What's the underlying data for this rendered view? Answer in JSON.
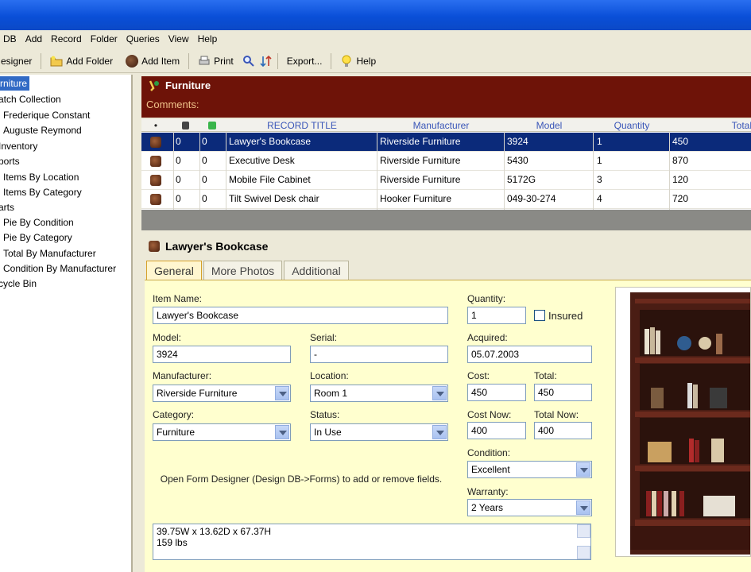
{
  "menu": [
    "n DB",
    "Add",
    "Record",
    "Folder",
    "Queries",
    "View",
    "Help"
  ],
  "toolbar": {
    "designer": "esigner",
    "add_folder": "Add Folder",
    "add_item": "Add Item",
    "print": "Print",
    "export": "Export...",
    "help": "Help"
  },
  "sidebar": [
    "rniture",
    "atch Collection",
    "Frederique Constant",
    "Auguste Reymond",
    "Inventory",
    "ports",
    "Items By Location",
    "Items By Category",
    "arts",
    "Pie By Condition",
    "Pie By Category",
    "Total By Manufacturer",
    "Condition By Manufacturer",
    "cycle Bin"
  ],
  "header": {
    "title": "Furniture",
    "comments": "Comments:"
  },
  "grid": {
    "columns": [
      "•",
      "",
      "",
      "RECORD TITLE",
      "Manufacturer",
      "Model",
      "Quantity",
      "Total"
    ],
    "rows": [
      {
        "a": "0",
        "b": "0",
        "title": "Lawyer's Bookcase",
        "manufacturer": "Riverside Furniture",
        "model": "3924",
        "quantity": "1",
        "total": "450"
      },
      {
        "a": "0",
        "b": "0",
        "title": "Executive Desk",
        "manufacturer": "Riverside Furniture",
        "model": "5430",
        "quantity": "1",
        "total": "870"
      },
      {
        "a": "0",
        "b": "0",
        "title": "Mobile File Cabinet",
        "manufacturer": "Riverside Furniture",
        "model": "5172G",
        "quantity": "3",
        "total": "120"
      },
      {
        "a": "0",
        "b": "0",
        "title": "Tilt Swivel Desk chair",
        "manufacturer": "Hooker Furniture",
        "model": "049-30-274",
        "quantity": "4",
        "total": "720"
      }
    ]
  },
  "detail": {
    "title": "Lawyer's Bookcase",
    "tabs": [
      "General",
      "More Photos",
      "Additional"
    ],
    "labels": {
      "item_name": "Item Name:",
      "model": "Model:",
      "serial": "Serial:",
      "manufacturer": "Manufacturer:",
      "location": "Location:",
      "category": "Category:",
      "status": "Status:",
      "quantity": "Quantity:",
      "insured": "Insured",
      "acquired": "Acquired:",
      "cost": "Cost:",
      "total": "Total:",
      "cost_now": "Cost Now:",
      "total_now": "Total Now:",
      "condition": "Condition:",
      "warranty": "Warranty:"
    },
    "values": {
      "item_name": "Lawyer's Bookcase",
      "model": "3924",
      "serial": "-",
      "manufacturer": "Riverside Furniture",
      "location": "Room 1",
      "category": "Furniture",
      "status": "In Use",
      "quantity": "1",
      "acquired": "05.07.2003",
      "cost": "450",
      "total": "450",
      "cost_now": "400",
      "total_now": "400",
      "condition": "Excellent",
      "warranty": "2 Years"
    },
    "note": "Open Form Designer (Design DB->Forms) to add or remove fields.",
    "memo_line1": "39.75W x 13.62D x 67.37H",
    "memo_line2": "159 lbs"
  }
}
